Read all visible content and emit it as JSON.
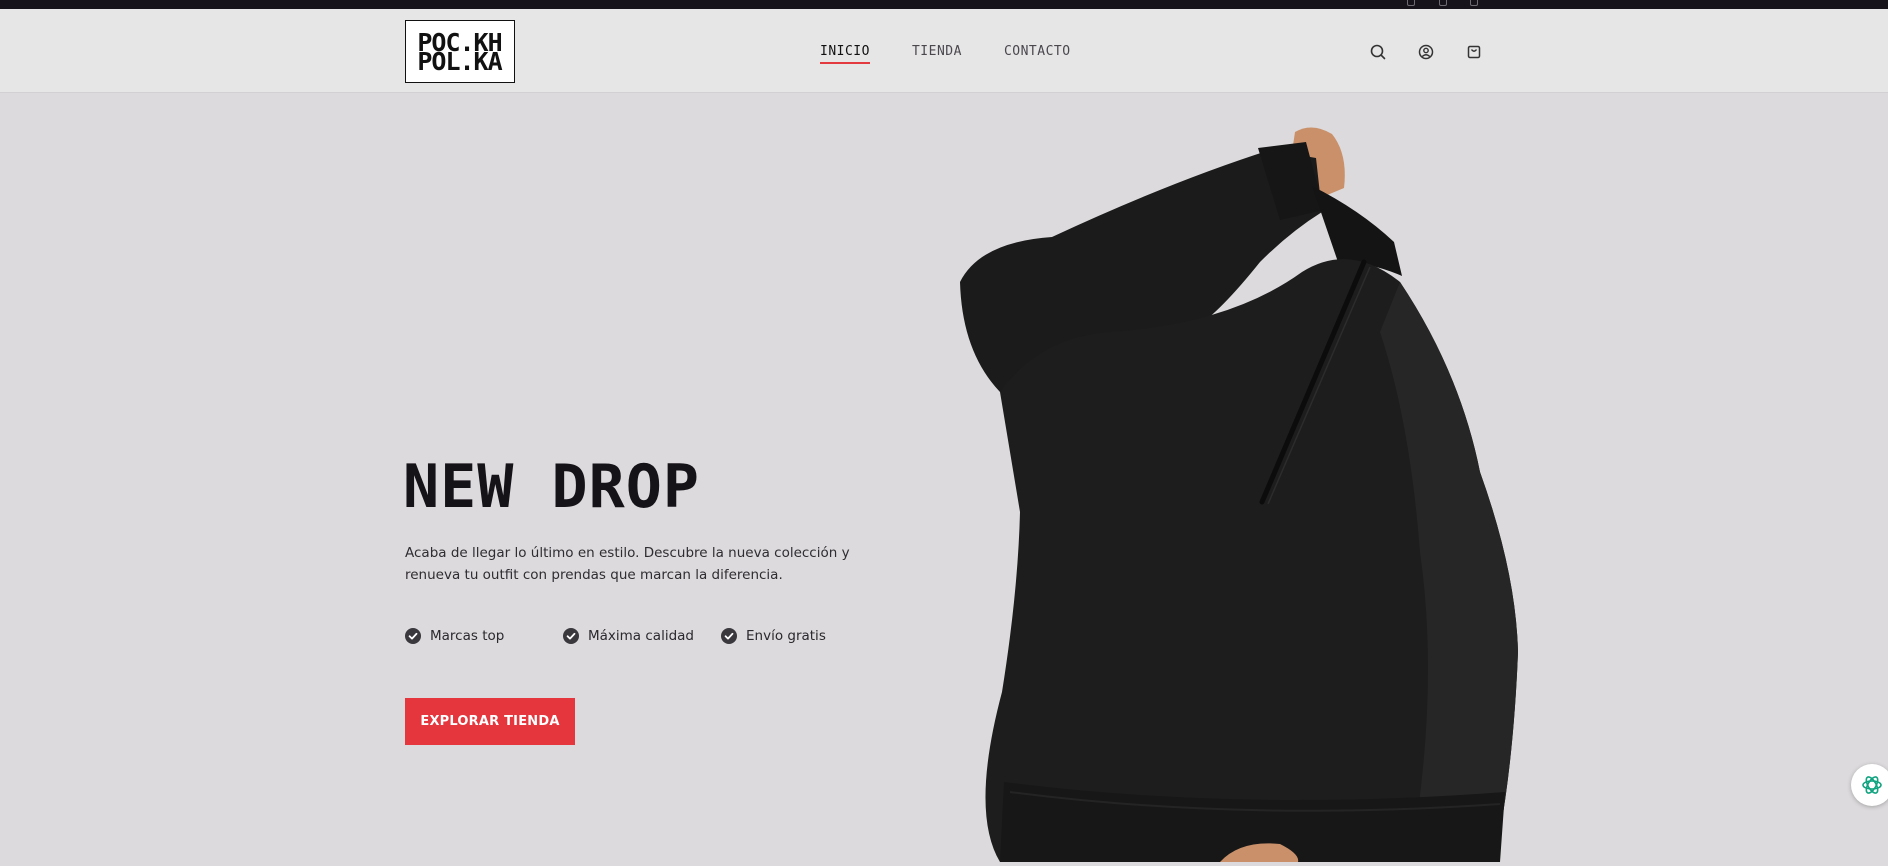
{
  "brand": {
    "logo_text_top": "POC.KH",
    "logo_text_bottom": "POL.KA"
  },
  "nav": {
    "items": [
      {
        "label": "INICIO",
        "active": true
      },
      {
        "label": "TIENDA",
        "active": false
      },
      {
        "label": "CONTACTO",
        "active": false
      }
    ]
  },
  "header_icons": [
    "search-icon",
    "user-icon",
    "shopping-bag-icon"
  ],
  "hero": {
    "title": "NEW DROP",
    "description": "Acaba de llegar lo último en estilo. Descubre la nueva colección y renueva tu outfit con prendas que marcan la diferencia.",
    "features": [
      {
        "label": "Marcas top",
        "icon": "check-circle-icon"
      },
      {
        "label": "Máxima calidad",
        "icon": "check-circle-icon"
      },
      {
        "label": "Envío gratis",
        "icon": "check-circle-icon"
      }
    ],
    "cta_label": "EXPLORAR TIENDA",
    "image": "black-jacket-model-photo"
  },
  "chat_widget": {
    "icon": "openai-icon"
  },
  "colors": {
    "accent": "#e5363d",
    "background": "#dcdadc",
    "header_bg": "#e7e6e7",
    "text_dark": "#151218",
    "topbar": "#16131a"
  }
}
